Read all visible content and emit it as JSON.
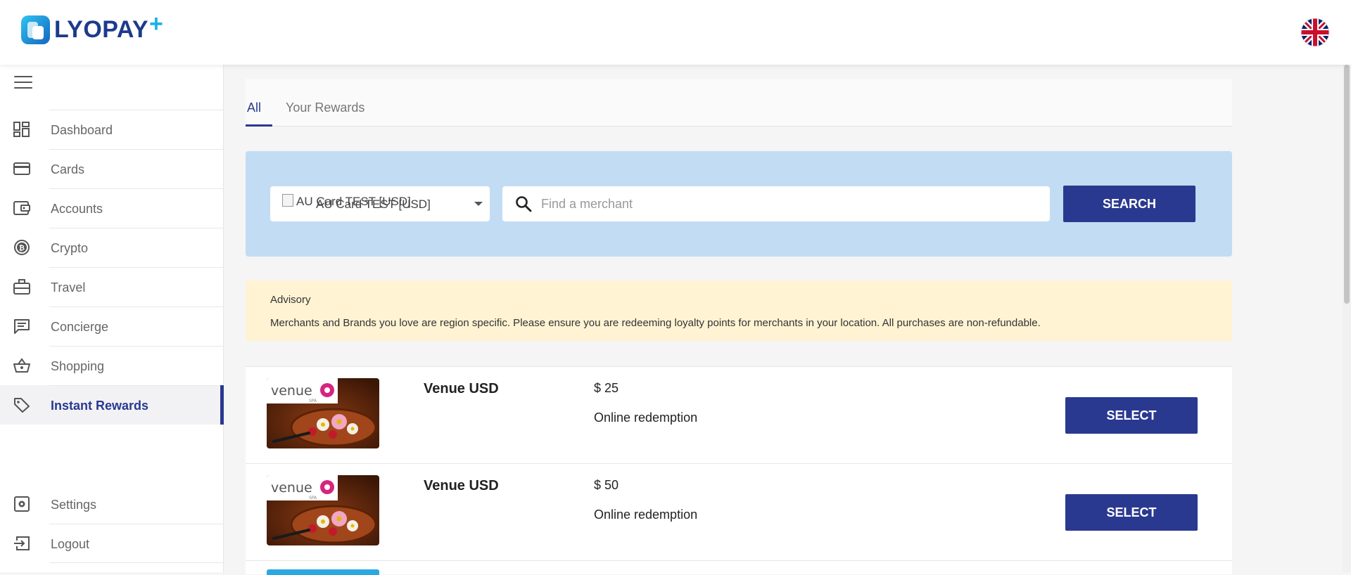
{
  "brand": {
    "name": "LYOPAY",
    "plus": "+"
  },
  "header": {
    "language_icon": "uk-flag-icon"
  },
  "sidebar": {
    "menu_icon": "hamburger-icon",
    "items": [
      {
        "label": "Dashboard",
        "icon": "dashboard-icon"
      },
      {
        "label": "Cards",
        "icon": "card-icon"
      },
      {
        "label": "Accounts",
        "icon": "wallet-icon"
      },
      {
        "label": "Crypto",
        "icon": "bitcoin-icon"
      },
      {
        "label": "Travel",
        "icon": "briefcase-icon"
      },
      {
        "label": "Concierge",
        "icon": "chat-icon"
      },
      {
        "label": "Shopping",
        "icon": "basket-icon"
      },
      {
        "label": "Instant Rewards",
        "icon": "tag-icon",
        "active": true
      }
    ],
    "bottom_items": [
      {
        "label": "Settings",
        "icon": "settings-icon"
      },
      {
        "label": "Logout",
        "icon": "logout-icon"
      }
    ]
  },
  "tabs": [
    {
      "label": "All",
      "active": true
    },
    {
      "label": "Your Rewards",
      "active": false
    }
  ],
  "search": {
    "card_image_alt": "AU Card TEST [USD]",
    "card_selected": "AU Card TEST [USD]",
    "placeholder": "Find a merchant",
    "value": "",
    "button_label": "SEARCH"
  },
  "advisory": {
    "title": "Advisory",
    "message": "Merchants and Brands you love are region specific. Please ensure you are redeeming loyalty points for merchants in your location. All purchases are non-refundable."
  },
  "rewards": [
    {
      "name": "Venue USD",
      "price": "$ 25",
      "type": "Online redemption",
      "button_label": "SELECT",
      "logo_text": "venue",
      "logo_sub": "SPA"
    },
    {
      "name": "Venue USD",
      "price": "$ 50",
      "type": "Online redemption",
      "button_label": "SELECT",
      "logo_text": "venue",
      "logo_sub": "SPA"
    }
  ],
  "colors": {
    "primary": "#2a3990",
    "search_panel": "#c2ddf3",
    "advisory_bg": "#fff3d3",
    "active_nav_bg": "#f2f2f4"
  }
}
